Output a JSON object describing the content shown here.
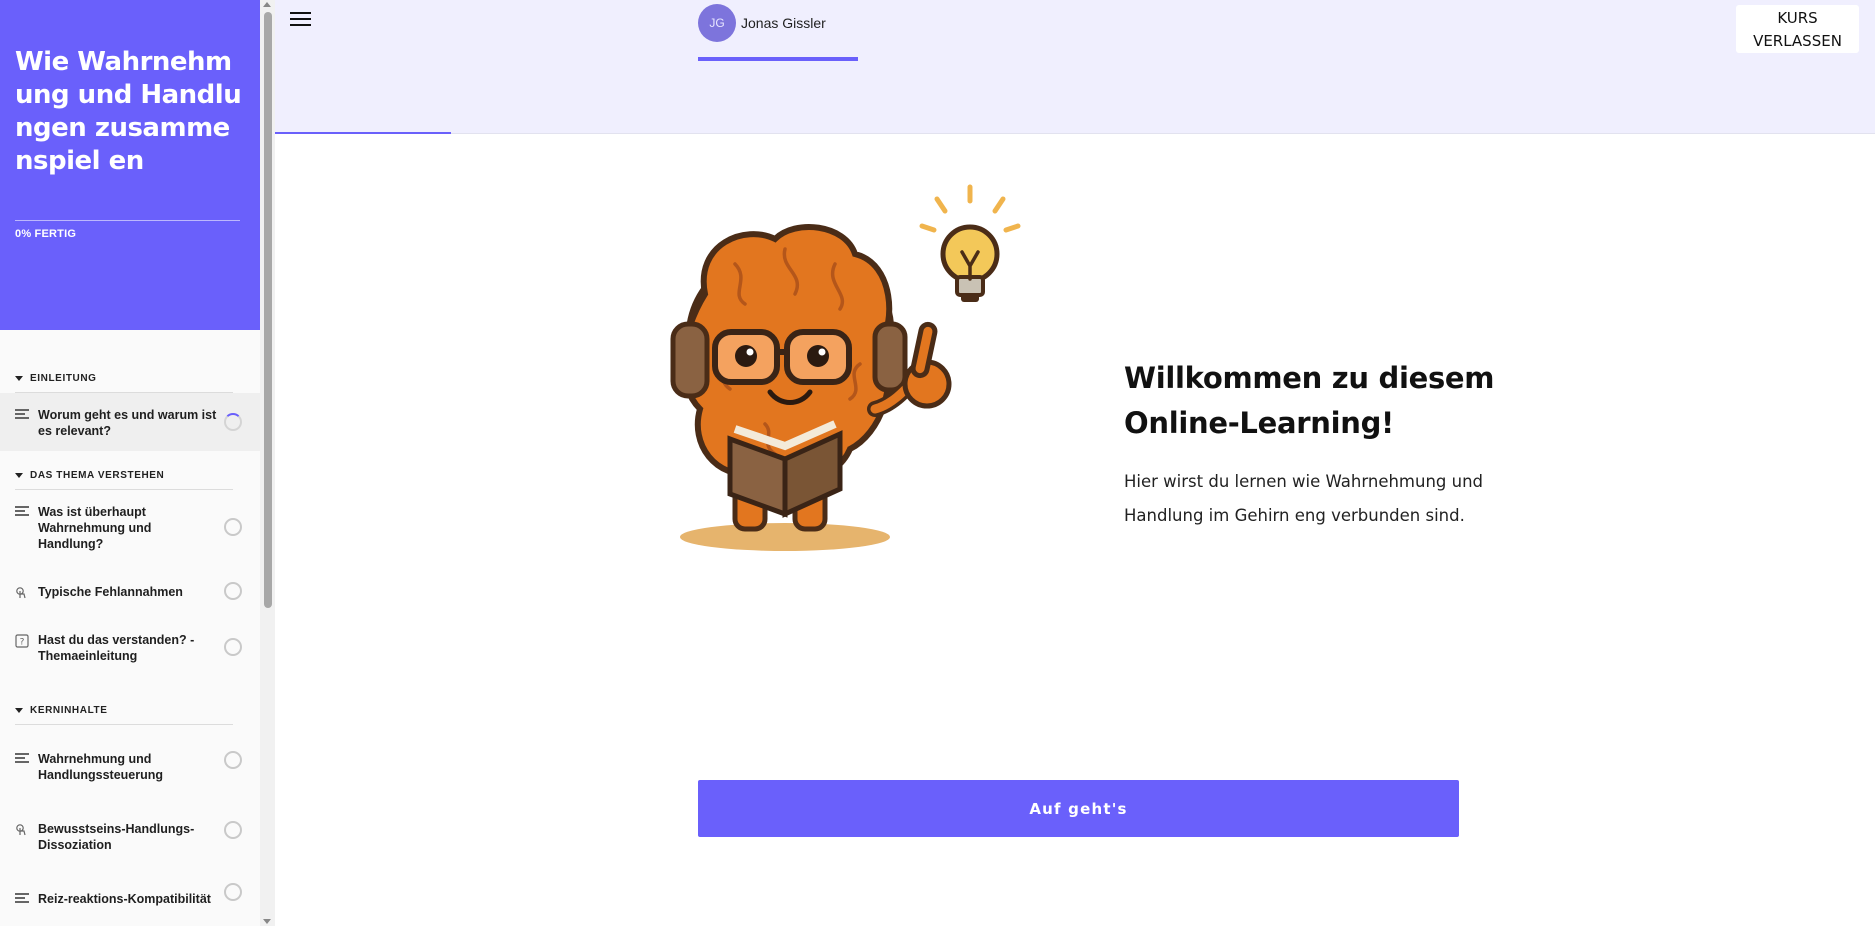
{
  "sidebar": {
    "course_title": "Wie Wahrnehmung und Handlungen zusammenspiel en",
    "progress_label": "0% FERTIG",
    "sections": [
      {
        "title": "EINLEITUNG",
        "lessons": [
          {
            "label": "Worum geht es und warum ist es relevant?",
            "icon": "lines-icon",
            "active": true
          }
        ]
      },
      {
        "title": "DAS THEMA VERSTEHEN",
        "lessons": [
          {
            "label": "Was ist überhaupt Wahrnehmung und Handlung?",
            "icon": "lines-icon"
          },
          {
            "label": "Typische Fehlannahmen",
            "icon": "touch-icon"
          },
          {
            "label": "Hast du das verstanden? - Themaeinleitung",
            "icon": "quiz-icon"
          }
        ]
      },
      {
        "title": "KERNINHALTE",
        "lessons": [
          {
            "label": "Wahrnehmung und Handlungssteuerung",
            "icon": "lines-icon"
          },
          {
            "label": "Bewusstseins-Handlungs-Dissoziation",
            "icon": "touch-icon"
          },
          {
            "label": "Reiz-reaktions-Kompatibilität",
            "icon": "lines-icon"
          }
        ]
      }
    ]
  },
  "header": {
    "user_initials": "JG",
    "user_name": "Jonas Gissler",
    "exit_label": "KURS VERLASSEN"
  },
  "main": {
    "heading": "Willkommen zu diesem Online-Learning!",
    "text": "Hier wirst du lernen wie Wahrnehmung und Handlung im Gehirn eng verbunden sind.",
    "start_label": "Auf geht's"
  },
  "colors": {
    "accent": "#6a60fb",
    "header_bg": "#f0effe",
    "brain": "#e2761f"
  }
}
